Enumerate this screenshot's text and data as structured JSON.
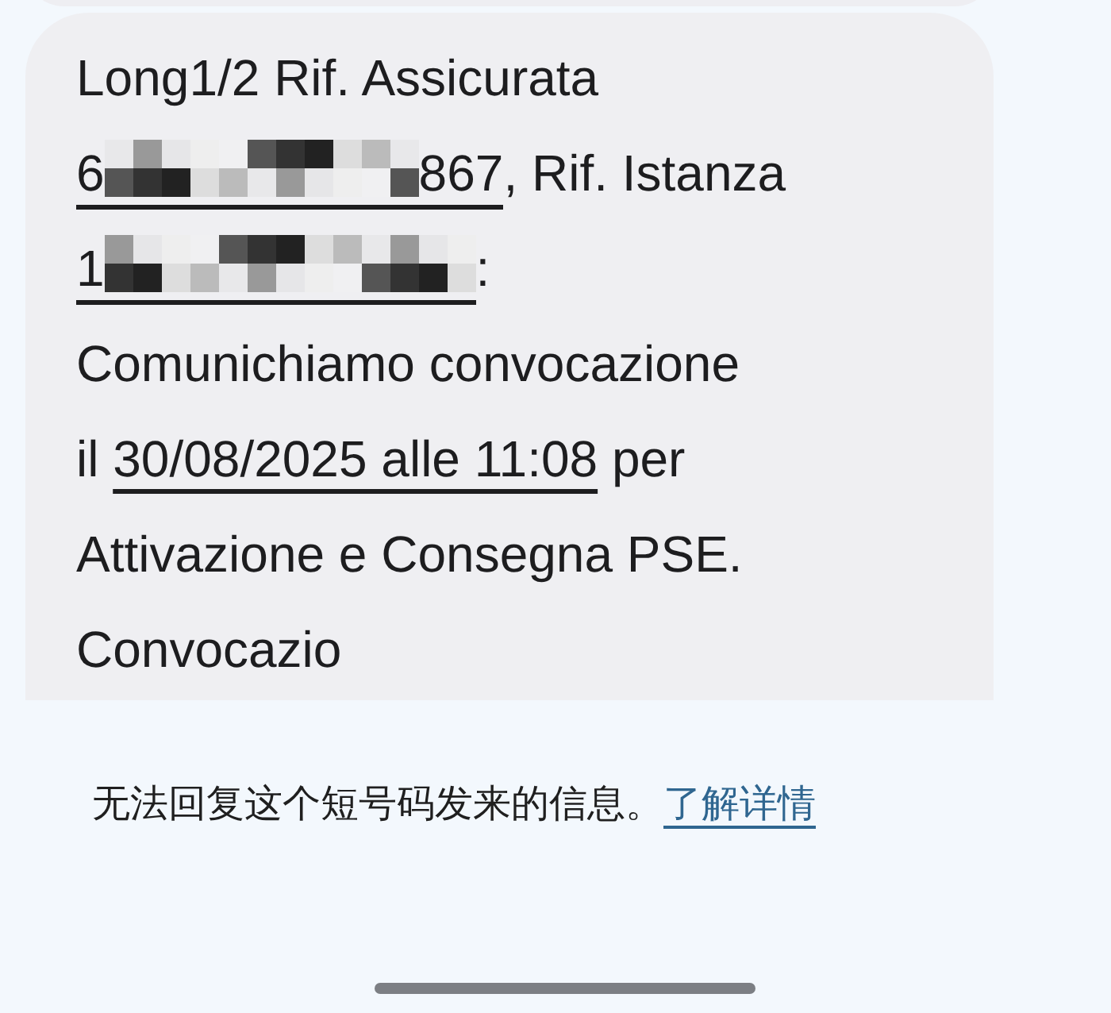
{
  "message": {
    "lines": [
      [
        {
          "kind": "text",
          "text": "Long1/2 Rif. Assicurata"
        }
      ],
      [
        {
          "kind": "redacted_link",
          "before": "6",
          "after": "867"
        },
        {
          "kind": "text",
          "text": ", Rif. Istanza"
        }
      ],
      [
        {
          "kind": "redacted_link",
          "before": "1"
        },
        {
          "kind": "text",
          "text": ":"
        }
      ],
      [
        {
          "kind": "text",
          "text": "Comunichiamo convocazione"
        }
      ],
      [
        {
          "kind": "text",
          "text": "il"
        },
        {
          "kind": "link",
          "text": "30/08/2025 alle 11:08"
        },
        {
          "kind": "text",
          "text": "per"
        }
      ],
      [
        {
          "kind": "text",
          "text": "Attivazione e Consegna PSE."
        }
      ],
      [
        {
          "kind": "text",
          "text": "Convocazio"
        }
      ]
    ]
  },
  "notice": {
    "text": "无法回复这个短号码发来的信息。",
    "link": "了解详情"
  }
}
